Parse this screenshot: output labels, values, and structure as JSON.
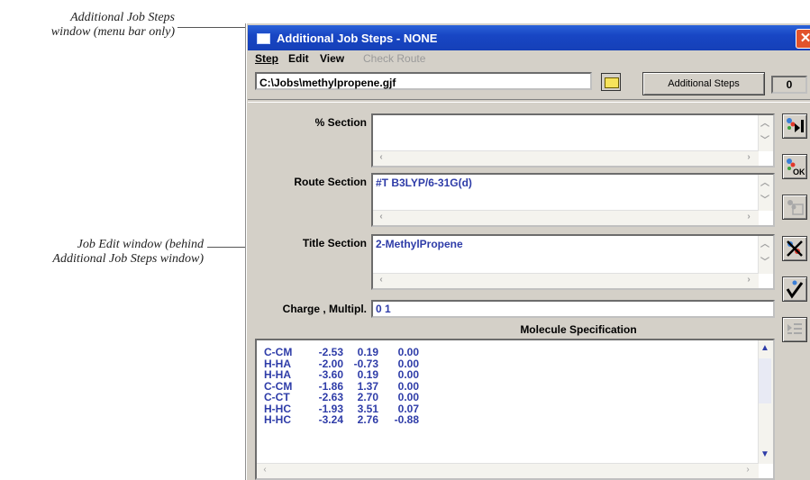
{
  "annotations": {
    "top": [
      "Additional Job Steps",
      "window (menu bar only)"
    ],
    "middle": [
      "Job Edit window (behind",
      "Additional Job Steps window)"
    ]
  },
  "window": {
    "title": "Additional Job Steps - NONE",
    "close_symbol": "✕",
    "menu": [
      {
        "label": "Step",
        "enabled": true
      },
      {
        "label": "Edit",
        "enabled": true
      },
      {
        "label": "View",
        "enabled": true
      },
      {
        "label": "Check Route",
        "enabled": false
      }
    ]
  },
  "file_path": "C:\\Jobs\\methylpropene.gjf",
  "additional_steps_label": "Additional Steps",
  "step_count": "0",
  "sections": {
    "percent": {
      "label": "% Section",
      "value": ""
    },
    "route": {
      "label": "Route Section",
      "value": "#T B3LYP/6-31G(d)"
    },
    "title": {
      "label": "Title Section",
      "value": "2-MethylPropene"
    }
  },
  "charge": {
    "label": "Charge , Multipl.",
    "value": "0 1"
  },
  "molecule": {
    "header": "Molecule Specification",
    "rows": [
      [
        "C-CM",
        "-2.53",
        "0.19",
        "0.00"
      ],
      [
        "H-HA",
        "-2.00",
        "-0.73",
        "0.00"
      ],
      [
        "H-HA",
        "-3.60",
        "0.19",
        "0.00"
      ],
      [
        "C-CM",
        "-1.86",
        "1.37",
        "0.00"
      ],
      [
        "C-CT",
        "-2.63",
        "2.70",
        "0.00"
      ],
      [
        "H-HC",
        "-1.93",
        "3.51",
        "0.07"
      ],
      [
        "H-HC",
        "-3.24",
        "2.76",
        "-0.88"
      ]
    ]
  },
  "side_buttons": [
    "run-icon",
    "ok-icon",
    "molecule-disabled-icon",
    "cancel-icon",
    "check-icon",
    "list-disabled-icon"
  ],
  "colors": {
    "titlebar": "#1846c4",
    "text_blue": "#2e3ca8",
    "face": "#d4d0c8"
  }
}
